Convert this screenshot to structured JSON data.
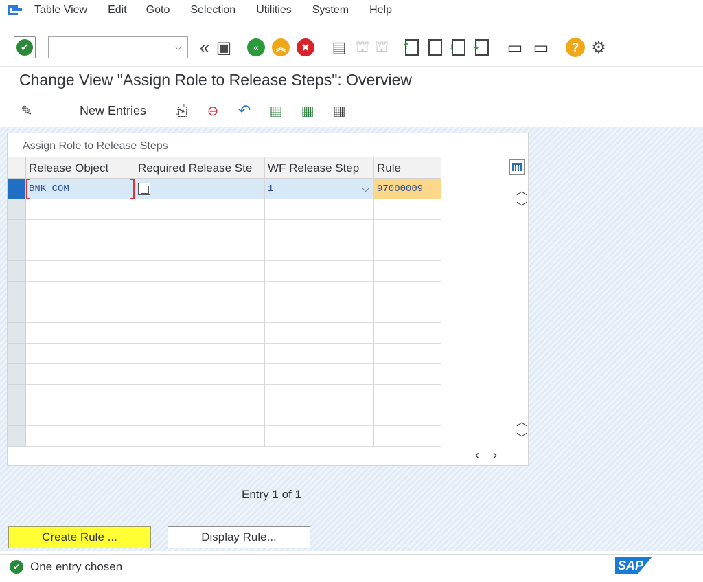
{
  "menu": {
    "items": [
      "Table View",
      "Edit",
      "Goto",
      "Selection",
      "Utilities",
      "System",
      "Help"
    ]
  },
  "toolbar": {
    "command_value": "",
    "icons": [
      "enter-icon",
      "back-icon",
      "save-icon",
      "exit-icon",
      "up-icon",
      "cancel-icon",
      "print-icon",
      "find-icon",
      "find-next-icon",
      "first-page-icon",
      "previous-page-icon",
      "next-page-icon",
      "last-page-icon",
      "create-session-icon",
      "shortcut-icon",
      "help-icon",
      "settings-icon"
    ]
  },
  "title": "Change View \"Assign Role to Release Steps\": Overview",
  "app_toolbar": {
    "new_entries": "New Entries"
  },
  "table": {
    "caption": "Assign Role to Release Steps",
    "columns": [
      "Release Object",
      "Required Release Ste",
      "WF Release Step",
      "Rule"
    ],
    "rows": [
      {
        "release_object": "BNK_COM",
        "required": "",
        "wf_step": "1",
        "rule": "97000009"
      }
    ],
    "empty_rows": 12
  },
  "entry_info": "Entry 1 of 1",
  "buttons": {
    "create_rule": "Create Rule ...",
    "display_rule": "Display Rule..."
  },
  "status": {
    "text": "One entry chosen"
  },
  "colors": {
    "accent": "#1f6fc5",
    "highlight": "#ffff33",
    "rule_cell": "#fcd98a",
    "selected_row": "#d7e8f7"
  },
  "logo": "SAP"
}
